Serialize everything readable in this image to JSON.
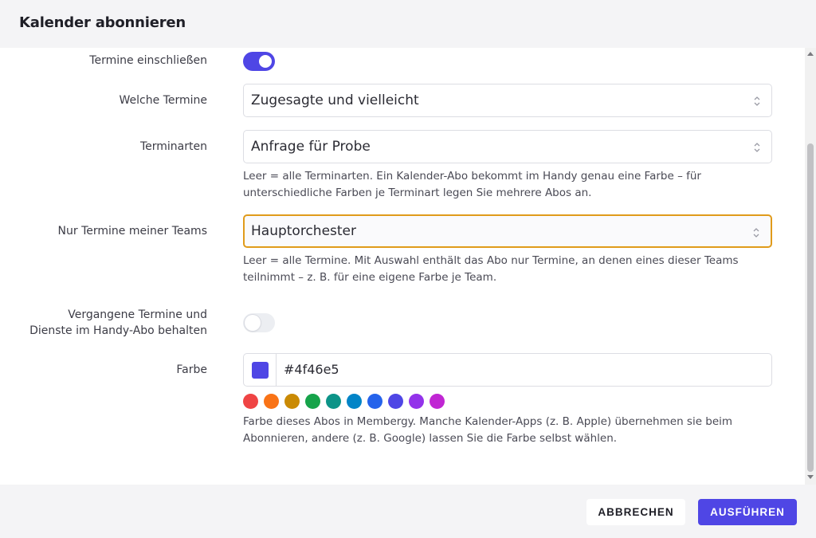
{
  "dialog": {
    "title": "Kalender abonnieren"
  },
  "form": {
    "include_events": {
      "label": "Termine einschließen",
      "on": true
    },
    "which_events": {
      "label": "Welche Termine",
      "value": "Zugesagte und vielleicht"
    },
    "event_types": {
      "label": "Terminarten",
      "value": "Anfrage für Probe",
      "help_line1": "Leer = alle Terminarten. Ein Kalender-Abo bekommt im Handy genau eine Farbe – für",
      "help_line2": "unterschiedliche Farben je Terminart legen Sie mehrere Abos an."
    },
    "my_teams": {
      "label": "Nur Termine meiner Teams",
      "value": "Hauptorchester",
      "help_line1": "Leer = alle Termine. Mit Auswahl enthält das Abo nur Termine, an denen eines dieser Teams",
      "help_line2": "teilnimmt – z. B. für eine eigene Farbe je Team."
    },
    "keep_past": {
      "label_line1": "Vergangene Termine und",
      "label_line2": "Dienste im Handy-Abo behalten",
      "on": false
    },
    "color": {
      "label": "Farbe",
      "value": "#4f46e5",
      "palette": [
        "#ef4444",
        "#f97316",
        "#ca8a04",
        "#16a34a",
        "#0d9488",
        "#0284c7",
        "#2563eb",
        "#4f46e5",
        "#9333ea",
        "#c026d3"
      ],
      "help_line1": "Farbe dieses Abos in Membergy. Manche Kalender-Apps (z. B. Apple) übernehmen sie beim",
      "help_line2": "Abonnieren, andere (z. B. Google) lassen Sie die Farbe selbst wählen."
    }
  },
  "footer": {
    "cancel_label": "ABBRECHEN",
    "run_label": "AUSFÜHREN"
  },
  "colors": {
    "accent": "#4f46e5",
    "focus_border": "#e09b1b"
  }
}
